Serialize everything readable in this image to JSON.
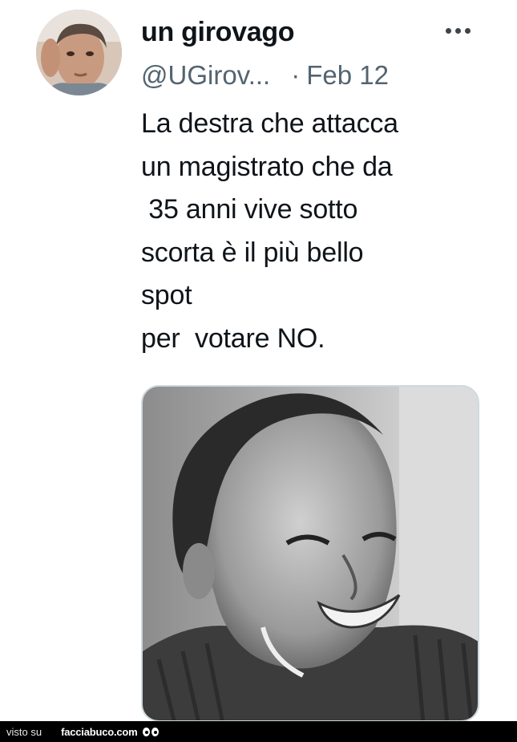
{
  "tweet": {
    "display_name": "un girovago",
    "handle": "@UGirov...",
    "separator": "·",
    "date": "Feb 12",
    "text": "La destra che attacca\nun magistrato che da\n 35 anni vive sotto\nscorta è il più bello\nspot\nper  votare NO."
  },
  "icons": {
    "more": "more-horizontal-icon",
    "avatar": "profile-avatar",
    "media": "photo-smiling-man"
  },
  "footer": {
    "visto_label": "visto su",
    "site_name": "facciabuco.com"
  },
  "colors": {
    "name": "#0f1419",
    "meta": "#536471",
    "media_border": "#cfd9de",
    "footer_bg": "#000000"
  }
}
